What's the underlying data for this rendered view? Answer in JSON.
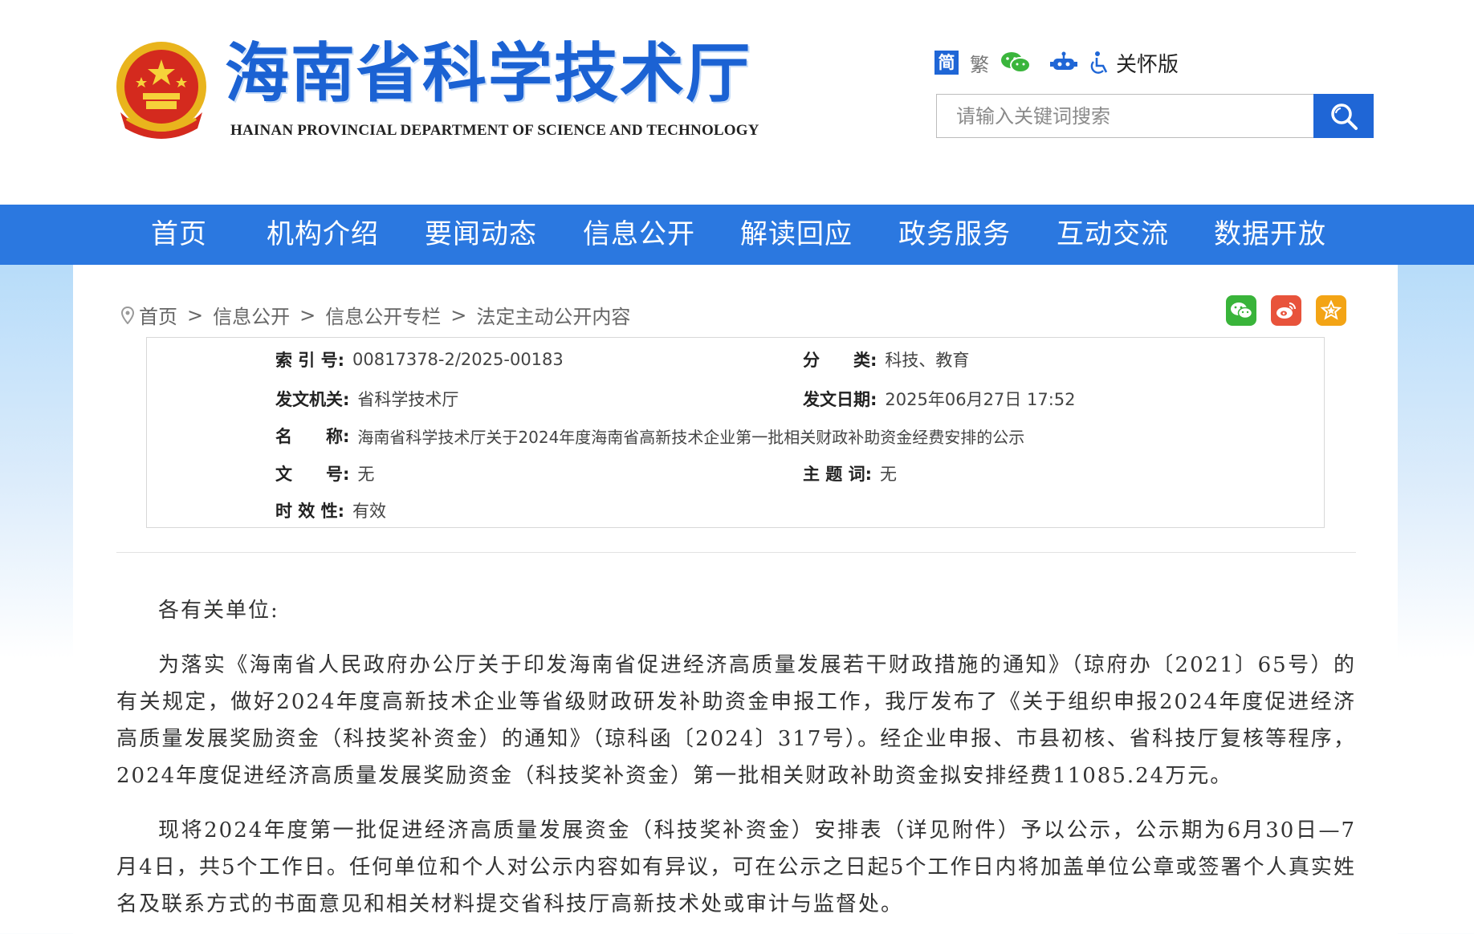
{
  "header": {
    "title": "海南省科学技术厅",
    "subtitle": "HAINAN PROVINCIAL DEPARTMENT OF SCIENCE AND TECHNOLOGY",
    "lang_simplified": "简",
    "lang_traditional": "繁",
    "care_mode": "关怀版",
    "search_placeholder": "请输入关键词搜索"
  },
  "nav": {
    "items": [
      {
        "label": "首页"
      },
      {
        "label": "机构介绍"
      },
      {
        "label": "要闻动态"
      },
      {
        "label": "信息公开"
      },
      {
        "label": "解读回应"
      },
      {
        "label": "政务服务"
      },
      {
        "label": "互动交流"
      },
      {
        "label": "数据开放"
      }
    ]
  },
  "breadcrumb": {
    "items": [
      "首页",
      "信息公开",
      "信息公开专栏",
      "法定主动公开内容"
    ],
    "separator": ">"
  },
  "meta": {
    "index_label": "索 引 号:",
    "index_value": "00817378-2/2025-00183",
    "category_label": "分　　类:",
    "category_value": "科技、教育",
    "issuer_label": "发文机关:",
    "issuer_value": "省科学技术厅",
    "date_label": "发文日期:",
    "date_value": "2025年06月27日 17:52",
    "name_label": "名　　称:",
    "name_value": "海南省科学技术厅关于2024年度海南省高新技术企业第一批相关财政补助资金经费安排的公示",
    "docno_label": "文　　号:",
    "docno_value": "无",
    "subject_label": "主 题 词:",
    "subject_value": "无",
    "validity_label": "时 效 性:",
    "validity_value": "有效"
  },
  "article": {
    "salutation": "各有关单位:",
    "paragraphs": [
      "为落实《海南省人民政府办公厅关于印发海南省促进经济高质量发展若干财政措施的通知》（琼府办〔2021〕65号）的有关规定，做好2024年度高新技术企业等省级财政研发补助资金申报工作，我厅发布了《关于组织申报2024年度促进经济高质量发展奖励资金（科技奖补资金）的通知》（琼科函〔2024〕317号）。经企业申报、市县初核、省科技厅复核等程序，2024年度促进经济高质量发展奖励资金（科技奖补资金）第一批相关财政补助资金拟安排经费11085.24万元。",
      "现将2024年度第一批促进经济高质量发展资金（科技奖补资金）安排表（详见附件）予以公示，公示期为6月30日—7月4日，共5个工作日。任何单位和个人对公示内容如有异议，可在公示之日起5个工作日内将加盖单位公章或签署个人真实姓名及联系方式的书面意见和相关材料提交省科技厅高新技术处或审计与监督处。"
    ]
  },
  "colors": {
    "brand_blue": "#1f66d6",
    "nav_blue": "#2b78e0",
    "wechat_green": "#39b43a",
    "weibo_red": "#e8533b",
    "fav_orange": "#f3a415"
  }
}
